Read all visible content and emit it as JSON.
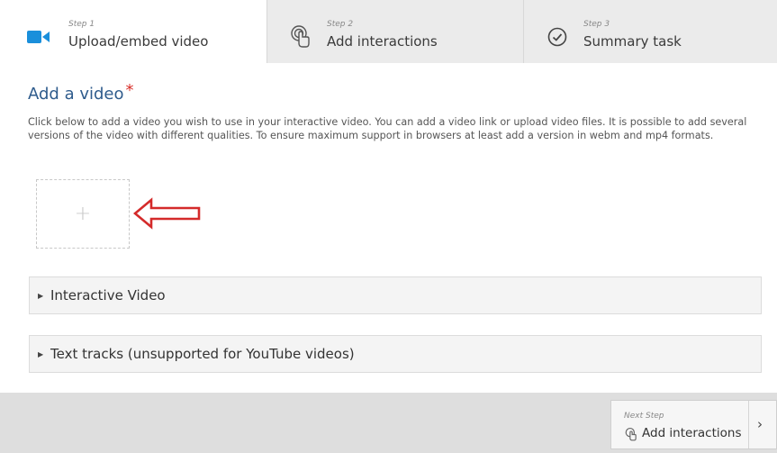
{
  "tabs": [
    {
      "step": "Step 1",
      "title": "Upload/embed video",
      "icon": "video-camera-icon"
    },
    {
      "step": "Step 2",
      "title": "Add interactions",
      "icon": "touch-pointer-icon"
    },
    {
      "step": "Step 3",
      "title": "Summary task",
      "icon": "check-circle-icon"
    }
  ],
  "main": {
    "heading": "Add a video",
    "required_mark": "*",
    "description": "Click below to add a video you wish to use in your interactive video. You can add a video link or upload video files. It is possible to add several versions of the video with different qualities. To ensure maximum support in browsers at least add a version in webm and mp4 formats.",
    "add_button_symbol": "+"
  },
  "accordions": [
    {
      "label": "Interactive Video"
    },
    {
      "label": "Text tracks (unsupported for YouTube videos)"
    }
  ],
  "footer": {
    "next_label": "Next Step",
    "next_title": "Add interactions",
    "chevron": "›"
  },
  "colors": {
    "accent_blue": "#2e5b8c",
    "video_icon": "#1a8fdb",
    "required_red": "#d9302b",
    "arrow_red": "#d42a2a"
  }
}
